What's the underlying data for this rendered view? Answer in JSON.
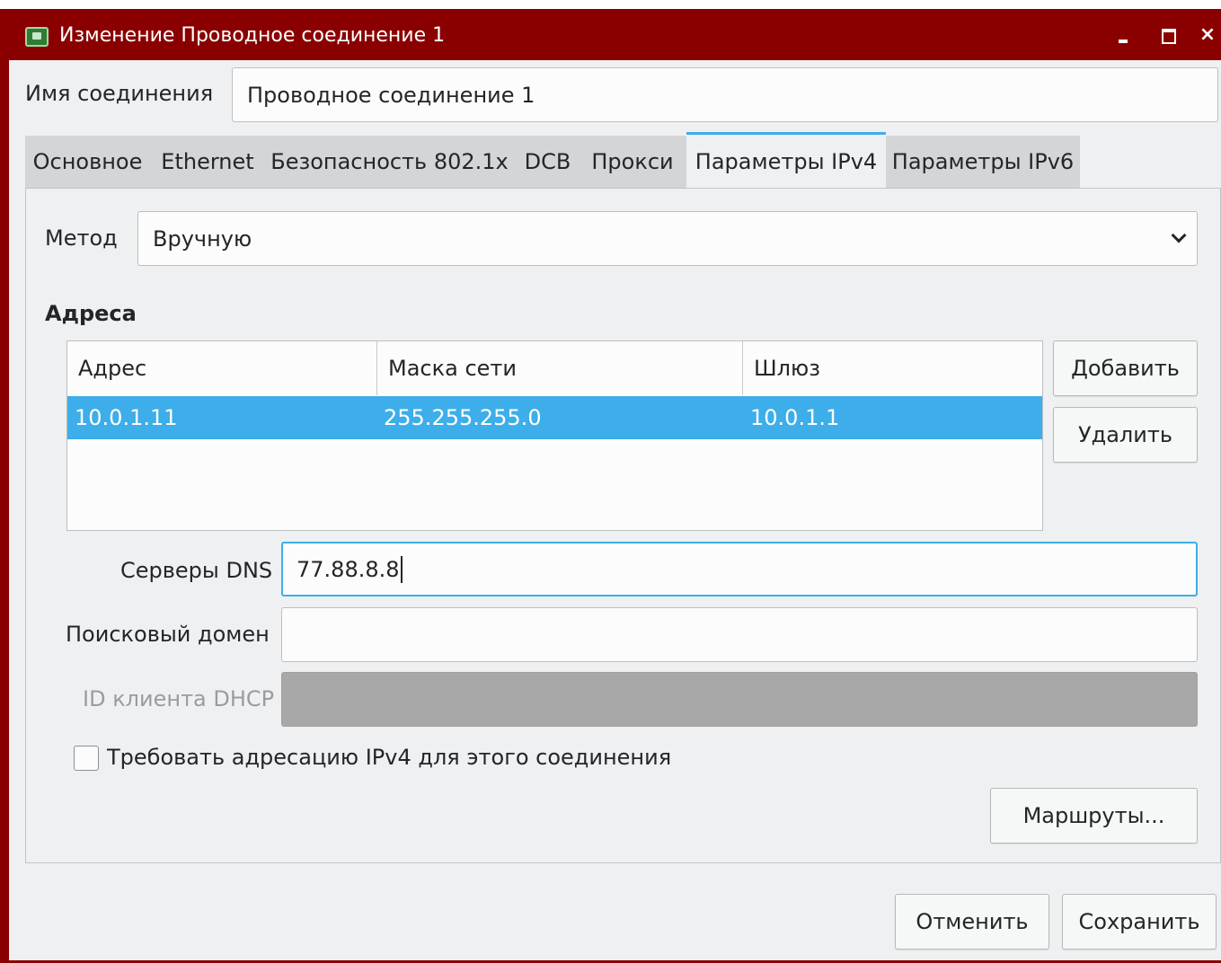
{
  "window": {
    "title": "Изменение Проводное соединение 1",
    "controls": {
      "minimize": "minimize",
      "maximize": "maximize",
      "close": "×"
    }
  },
  "connection": {
    "name_label": "Имя соединения",
    "name_value": "Проводное соединение 1"
  },
  "tabs": [
    {
      "label": "Основное",
      "active": false
    },
    {
      "label": "Ethernet",
      "active": false
    },
    {
      "label": "Безопасность 802.1x",
      "active": false
    },
    {
      "label": "DCB",
      "active": false
    },
    {
      "label": "Прокси",
      "active": false
    },
    {
      "label": "Параметры IPv4",
      "active": true
    },
    {
      "label": "Параметры IPv6",
      "active": false
    }
  ],
  "ipv4": {
    "method_label": "Метод",
    "method_value": "Вручную",
    "addresses_heading": "Адреса",
    "columns": [
      "Адрес",
      "Маска сети",
      "Шлюз"
    ],
    "rows": [
      {
        "address": "10.0.1.11",
        "netmask": "255.255.255.0",
        "gateway": "10.0.1.1",
        "selected": true
      }
    ],
    "add_button": "Добавить",
    "delete_button": "Удалить",
    "dns_label": "Серверы DNS",
    "dns_value": "77.88.8.8",
    "search_domain_label": "Поисковый домен",
    "search_domain_value": "",
    "dhcp_client_id_label": "ID клиента DHCP",
    "dhcp_client_id_value": "",
    "require_ipv4_label": "Требовать адресацию IPv4 для этого соединения",
    "require_ipv4_checked": false,
    "routes_button": "Маршруты..."
  },
  "footer": {
    "cancel_button": "Отменить",
    "save_button": "Сохранить"
  },
  "colors": {
    "titlebar": "#8a0000",
    "accent": "#3daee9",
    "background": "#eff0f1"
  }
}
